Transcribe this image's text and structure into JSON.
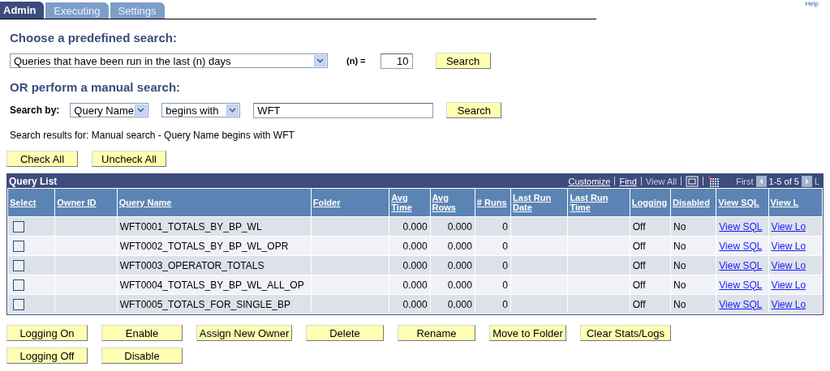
{
  "tabs": [
    {
      "label": "Admin",
      "selected": true
    },
    {
      "label": "Executing",
      "selected": false
    },
    {
      "label": "Settings",
      "selected": false
    }
  ],
  "help_link": "Help",
  "predefined": {
    "heading": "Choose a predefined search:",
    "select_value": "Queries that have been run in the last (n) days",
    "n_label": "(n) =",
    "n_value": "10",
    "button": "Search"
  },
  "manual": {
    "heading": "OR perform a manual search:",
    "label": "Search by:",
    "field_value": "Query Name",
    "operator_value": "begins with",
    "text_value": "WFT",
    "button": "Search"
  },
  "results_text": "Search results for: Manual search - Query Name begins with WFT",
  "check_buttons": [
    "Check All",
    "Uncheck All"
  ],
  "grid": {
    "title": "Query List",
    "nav_links": [
      {
        "label": "Customize",
        "disabled": false
      },
      {
        "label": "Find",
        "disabled": false
      },
      {
        "label": "View All",
        "disabled": true
      }
    ],
    "first": "First",
    "range": "1-5 of 5",
    "last": "L",
    "columns": [
      "Select",
      "Owner ID",
      "Query Name",
      "Folder",
      "Avg Time",
      "Avg Rows",
      "# Runs",
      "Last Run Date",
      "Last Run Time",
      "Logging",
      "Disabled",
      "View SQL",
      "View L"
    ],
    "rows": [
      {
        "checked": false,
        "owner": "",
        "name": "WFT0001_TOTALS_BY_BP_WL",
        "folder": "",
        "avg_time": "0.000",
        "avg_rows": "0.000",
        "runs": "0",
        "date": "",
        "time": "",
        "logging": "Off",
        "disabled": "No",
        "view_sql": "View SQL",
        "view_log": "View Lo"
      },
      {
        "checked": false,
        "owner": "",
        "name": "WFT0002_TOTALS_BY_BP_WL_OPR",
        "folder": "",
        "avg_time": "0.000",
        "avg_rows": "0.000",
        "runs": "0",
        "date": "",
        "time": "",
        "logging": "Off",
        "disabled": "No",
        "view_sql": "View SQL",
        "view_log": "View Lo"
      },
      {
        "checked": false,
        "owner": "",
        "name": "WFT0003_OPERATOR_TOTALS",
        "folder": "",
        "avg_time": "0.000",
        "avg_rows": "0.000",
        "runs": "0",
        "date": "",
        "time": "",
        "logging": "Off",
        "disabled": "No",
        "view_sql": "View SQL",
        "view_log": "View Lo"
      },
      {
        "checked": false,
        "owner": "",
        "name": "WFT0004_TOTALS_BY_BP_WL_ALL_OP",
        "folder": "",
        "avg_time": "0.000",
        "avg_rows": "0.000",
        "runs": "0",
        "date": "",
        "time": "",
        "logging": "Off",
        "disabled": "No",
        "view_sql": "View SQL",
        "view_log": "View Lo"
      },
      {
        "checked": false,
        "owner": "",
        "name": "WFT0005_TOTALS_FOR_SINGLE_BP",
        "folder": "",
        "avg_time": "0.000",
        "avg_rows": "0.000",
        "runs": "0",
        "date": "",
        "time": "",
        "logging": "Off",
        "disabled": "No",
        "view_sql": "View SQL",
        "view_log": "View Lo"
      }
    ]
  },
  "action_buttons": [
    [
      "Logging On",
      "Enable",
      "Assign New Owner",
      "Delete",
      "Rename",
      "Move to Folder",
      "Clear Stats/Logs"
    ],
    [
      "Logging Off",
      "Disable"
    ]
  ]
}
